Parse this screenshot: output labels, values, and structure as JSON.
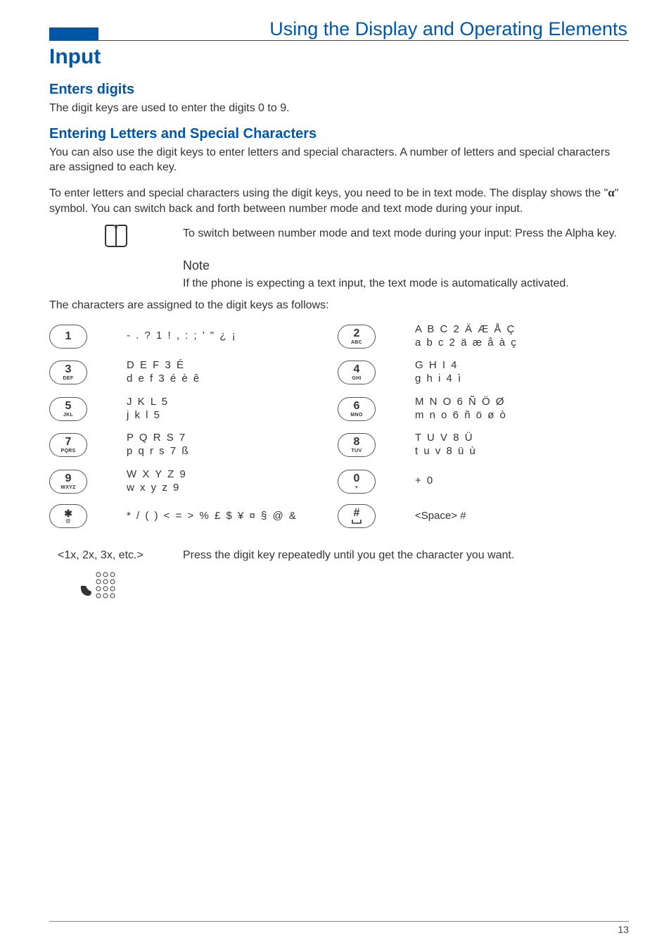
{
  "header": {
    "title": "Using the Display and Operating Elements"
  },
  "h1": "Input",
  "sec1": {
    "title": "Enters digits",
    "p": "The digit keys are used to enter the digits 0 to 9."
  },
  "sec2": {
    "title": "Entering Letters and Special Characters",
    "p1": "You can also use the digit keys to enter letters and special characters. A number of letters and special characters are assigned to each key.",
    "p2a": "To enter letters and special characters using the digit keys, you need to be in text mode. The display shows the \"",
    "alpha": "α",
    "p2b": "\" symbol. You can switch back and forth between number mode and text mode during your input."
  },
  "alpha_instr": "To switch between number mode and text mode during your input: Press the Alpha key.",
  "note": {
    "title": "Note",
    "text": "If the phone is expecting a text input, the text mode is automatically activated."
  },
  "assign_intro": "The characters are assigned to the digit keys as follows:",
  "keys": {
    "k1": {
      "big": "1",
      "small": "",
      "chars": "- . ? 1 ! , : ; ' \" ¿ ¡"
    },
    "k2": {
      "big": "2",
      "small": "ABC",
      "chars": "A B C 2 Ä Æ Å Ç\na b c 2 ä æ å à ç"
    },
    "k3": {
      "big": "3",
      "small": "DEF",
      "chars": "D E F 3 É\nd e f 3 é è ê"
    },
    "k4": {
      "big": "4",
      "small": "GHI",
      "chars": "G H I 4\ng h i 4 ì"
    },
    "k5": {
      "big": "5",
      "small": "JKL",
      "chars": "J K L 5\nj k l 5"
    },
    "k6": {
      "big": "6",
      "small": "MNO",
      "chars": "M N O 6 Ñ Ö Ø\nm n o 6 ñ ö ø ò"
    },
    "k7": {
      "big": "7",
      "small": "PQRS",
      "chars": "P Q R S 7\np q r s 7 ß"
    },
    "k8": {
      "big": "8",
      "small": "TUV",
      "chars": "T U V 8 Ü\nt u v 8 ü ù"
    },
    "k9": {
      "big": "9",
      "small": "WXYZ",
      "chars": "W X Y Z 9\nw x y z 9"
    },
    "k0": {
      "big": "0",
      "small": "+",
      "chars": "+ 0"
    },
    "kstar": {
      "big": "✱",
      "small": "@",
      "chars": "* / ( ) < = > % £ $    ¥ ¤ § @ &"
    },
    "khash": {
      "big": "#",
      "small": "",
      "chars": "<Space> #"
    }
  },
  "press": {
    "left": "<1x, 2x, 3x, etc.>",
    "right": "Press the digit key repeatedly until you get the character you want."
  },
  "footer": "13"
}
